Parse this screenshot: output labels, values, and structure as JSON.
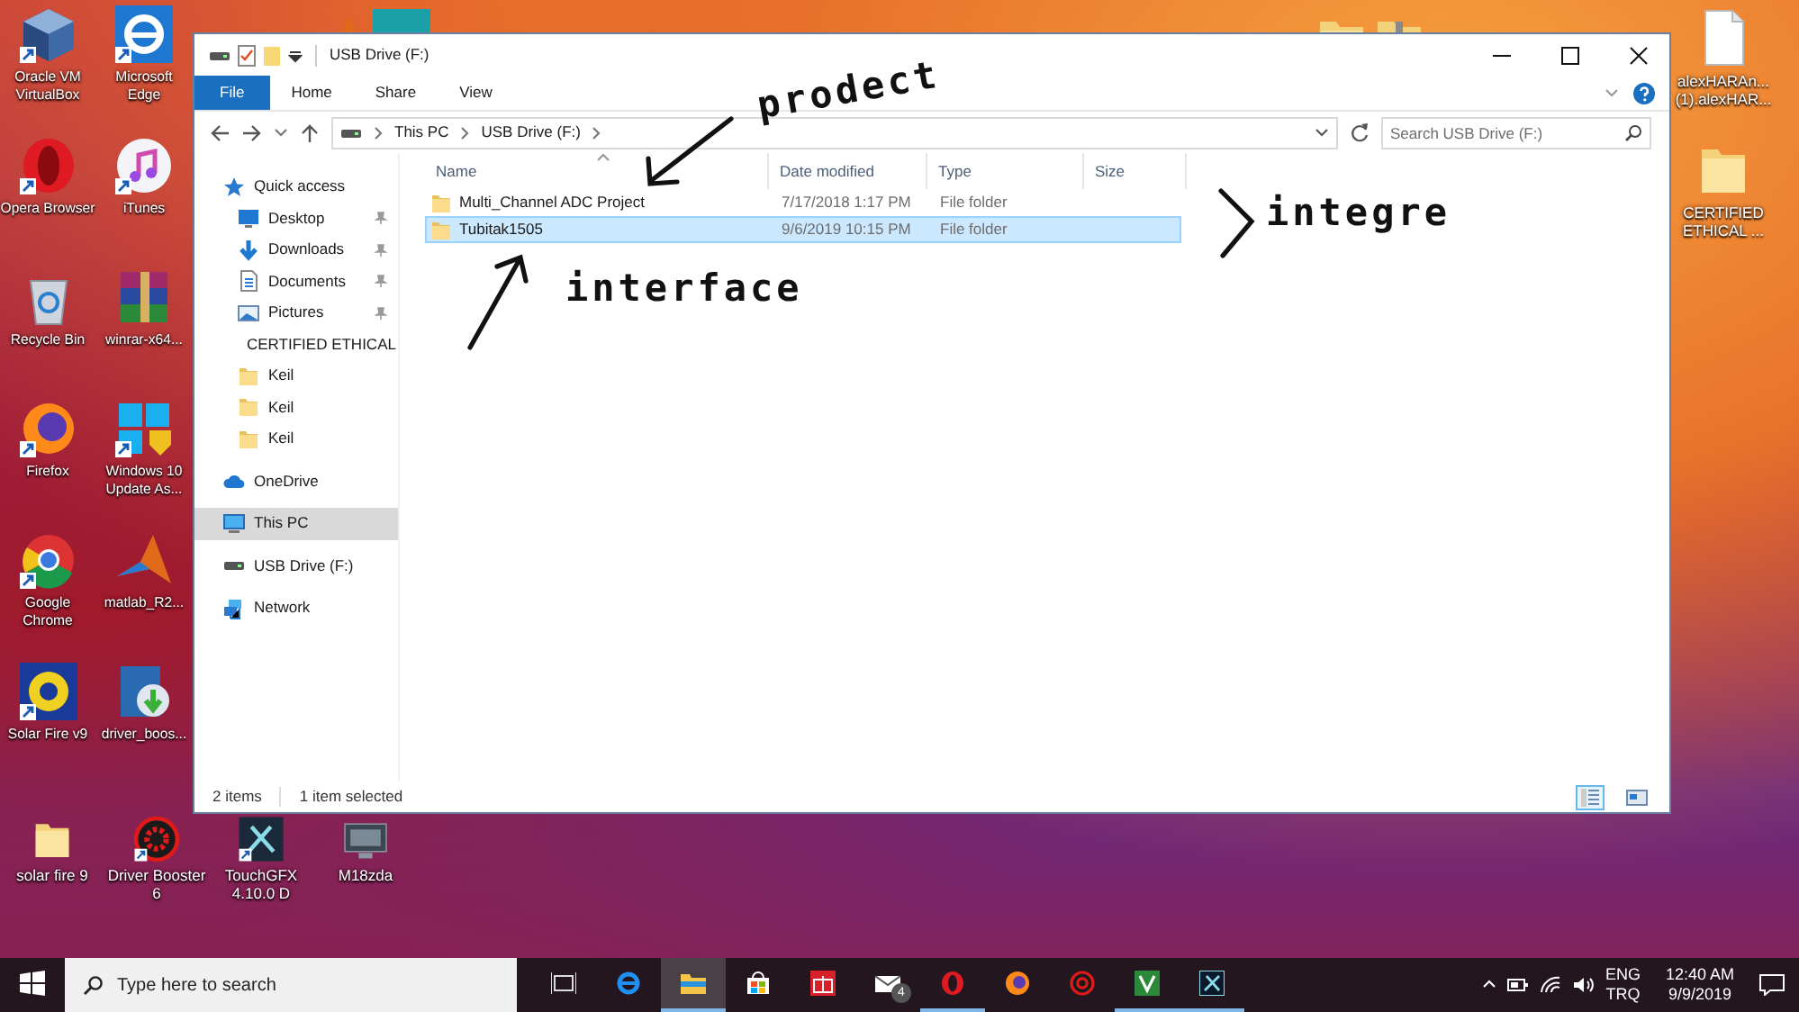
{
  "desktop": {
    "left_icons": [
      {
        "label": "Oracle VM VirtualBox",
        "kind": "cube",
        "shortcut": true
      },
      {
        "label": "Microsoft Edge",
        "kind": "edge",
        "shortcut": true
      },
      {
        "label": "Opera Browser",
        "kind": "opera",
        "shortcut": true
      },
      {
        "label": "iTunes",
        "kind": "music",
        "shortcut": true
      },
      {
        "label": "Recycle Bin",
        "kind": "bin",
        "shortcut": false
      },
      {
        "label": "winrar-x64...",
        "kind": "archive",
        "shortcut": false
      },
      {
        "label": "Firefox",
        "kind": "firefox",
        "shortcut": true
      },
      {
        "label": "Windows 10 Update As...",
        "kind": "windows",
        "shortcut": true
      },
      {
        "label": "Google Chrome",
        "kind": "chrome",
        "shortcut": true
      },
      {
        "label": "matlab_R2...",
        "kind": "peak",
        "shortcut": false
      },
      {
        "label": "Solar Fire v9",
        "kind": "sun",
        "shortcut": true
      },
      {
        "label": "driver_boos...",
        "kind": "installer",
        "shortcut": false
      }
    ],
    "bottom_icons": [
      {
        "label": "solar fire 9",
        "kind": "folder",
        "shortcut": false
      },
      {
        "label": "Driver Booster 6",
        "kind": "booster",
        "shortcut": true
      },
      {
        "label": "TouchGFX 4.10.0 D",
        "kind": "touchgfx",
        "shortcut": true
      },
      {
        "label": "M18zda",
        "kind": "monitor",
        "shortcut": false
      }
    ],
    "right_icons": [
      {
        "label": "alexHARAn... (1).alexHAR...",
        "kind": "document",
        "shortcut": false
      },
      {
        "label": "CERTIFIED ETHICAL ...",
        "kind": "folder",
        "shortcut": false
      }
    ],
    "hidden_icons": [
      {
        "kind": "peak"
      },
      {
        "kind": "wifi"
      },
      {
        "kind": "folder"
      },
      {
        "kind": "zip"
      }
    ]
  },
  "window": {
    "title": "USB Drive (F:)",
    "ribbon_tabs": [
      {
        "label": "File",
        "kind": "file"
      },
      {
        "label": "Home",
        "kind": "tab"
      },
      {
        "label": "Share",
        "kind": "tab"
      },
      {
        "label": "View",
        "kind": "tab"
      }
    ],
    "breadcrumbs": [
      "This PC",
      "USB Drive (F:)"
    ],
    "search": {
      "placeholder": "Search USB Drive (F:)"
    },
    "navigation": [
      {
        "label": "Quick access",
        "kind": "star",
        "selected": false,
        "children": [
          {
            "label": "Desktop",
            "kind": "desktop",
            "pinned": true,
            "selected": false
          },
          {
            "label": "Downloads",
            "kind": "download",
            "pinned": true,
            "selected": false
          },
          {
            "label": "Documents",
            "kind": "document",
            "pinned": true,
            "selected": false
          },
          {
            "label": "Pictures",
            "kind": "picture",
            "pinned": true,
            "selected": false
          },
          {
            "label": "CERTIFIED ETHICAL",
            "kind": "folder",
            "pinned": false,
            "selected": false
          },
          {
            "label": "Keil",
            "kind": "folder",
            "pinned": false,
            "selected": false
          },
          {
            "label": "Keil",
            "kind": "folder",
            "pinned": false,
            "selected": false
          },
          {
            "label": "Keil",
            "kind": "folder",
            "pinned": false,
            "selected": false
          }
        ]
      },
      {
        "label": "OneDrive",
        "kind": "cloud",
        "selected": false
      },
      {
        "label": "This PC",
        "kind": "pc",
        "selected": true
      },
      {
        "label": "USB Drive (F:)",
        "kind": "drive",
        "selected": false
      },
      {
        "label": "Network",
        "kind": "network",
        "selected": false
      }
    ],
    "columns": [
      {
        "label": "Name",
        "sorted": true
      },
      {
        "label": "Date modified",
        "sorted": false
      },
      {
        "label": "Type",
        "sorted": false
      },
      {
        "label": "Size",
        "sorted": false
      }
    ],
    "files": [
      {
        "name": "Multi_Channel ADC Project",
        "date_modified": "7/17/2018 1:17 PM",
        "type": "File folder",
        "selected": false
      },
      {
        "name": "Tubitak1505",
        "date_modified": "9/6/2019 10:15 PM",
        "type": "File folder",
        "selected": true
      }
    ],
    "status_bar": {
      "item_count": "2 items",
      "selection": "1 item selected"
    },
    "view_modes": [
      {
        "kind": "details",
        "selected": true
      },
      {
        "kind": "large-icons",
        "selected": false
      }
    ]
  },
  "annotations": [
    {
      "text": "prodect",
      "kind": "product"
    },
    {
      "text": "interface",
      "kind": "interface"
    },
    {
      "text": "integre",
      "kind": "integre"
    }
  ],
  "taskbar": {
    "search": {
      "placeholder": "Type here to search"
    },
    "apps": [
      {
        "kind": "taskview",
        "running": false,
        "active": false
      },
      {
        "kind": "edge",
        "running": false,
        "active": false
      },
      {
        "kind": "explorer",
        "running": true,
        "active": true
      },
      {
        "kind": "store",
        "running": false,
        "active": false
      },
      {
        "kind": "gift",
        "running": false,
        "active": false
      },
      {
        "kind": "mail",
        "running": false,
        "active": false,
        "badge": "4"
      },
      {
        "kind": "opera",
        "running": true,
        "active": false
      },
      {
        "kind": "firefox",
        "running": false,
        "active": false
      },
      {
        "kind": "booster",
        "running": false,
        "active": false
      },
      {
        "kind": "keil",
        "running": true,
        "active": false
      },
      {
        "kind": "touchgfx",
        "running": true,
        "active": false
      }
    ],
    "language": "ENG",
    "layout": "TRQ",
    "time": "12:40 AM",
    "date": "9/9/2019"
  }
}
